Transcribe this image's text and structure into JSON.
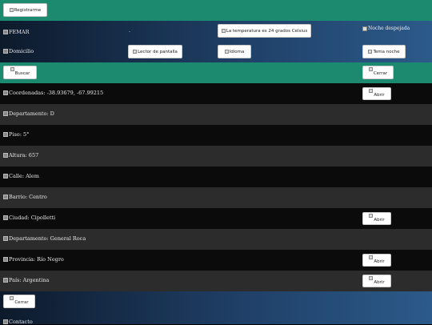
{
  "register_label": "Registrarme",
  "header": {
    "site_name": "FEMAR",
    "separator": "-",
    "temperature": "La temperatura es 24 grados Celsius",
    "weather": "Noche despejada",
    "address_label": "Domicilio",
    "screen_reader": "Lector de pantalla",
    "language": "Idioma",
    "theme": "Tema noche"
  },
  "search_label": "Buscar",
  "close_label": "Cerrar",
  "open_label": "Abrir",
  "address_rows": [
    {
      "text": "Coordenadas: -38.93679, -67.99215",
      "has_button": true
    },
    {
      "text": "Departamento: D",
      "has_button": false
    },
    {
      "text": "Piso: 5°",
      "has_button": false
    },
    {
      "text": "Altura: 657",
      "has_button": false
    },
    {
      "text": "Calle: Alem",
      "has_button": false
    },
    {
      "text": "Barrio: Centro",
      "has_button": false
    },
    {
      "text": "Ciudad: Cipolletti",
      "has_button": true
    },
    {
      "text": "Departamento: General Roca",
      "has_button": false
    },
    {
      "text": "Provincia: Río Negro",
      "has_button": true
    },
    {
      "text": "País: Argentina",
      "has_button": true
    }
  ],
  "footer_close_label": "Cerrar",
  "contact_label": "Contacto",
  "colors": {
    "green": "#1c8a6e",
    "dark_row": "#0b0b0b",
    "grey_row": "#2c2c2c",
    "blue": "#2c5a8a"
  }
}
